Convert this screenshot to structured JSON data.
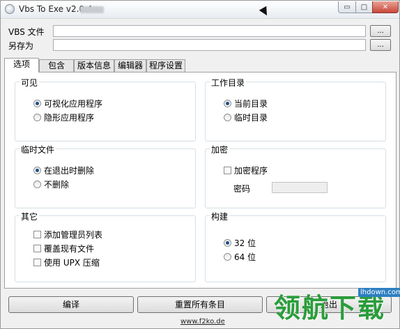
{
  "window": {
    "title": "Vbs To Exe v2.0.4",
    "controls": {
      "minimize": "▭",
      "maximize": "□",
      "close": "✕"
    }
  },
  "inputs": {
    "vbs_label": "VBS 文件",
    "vbs_value": "",
    "vbs_browse": "...",
    "saveas_label": "另存为",
    "saveas_value": "",
    "saveas_browse": "..."
  },
  "tabs": [
    "选项",
    "包含",
    "版本信息",
    "编辑器",
    "程序设置"
  ],
  "active_tab": "选项",
  "groups": {
    "visible": {
      "title": "可见",
      "options": [
        {
          "label": "可视化应用程序",
          "selected": true
        },
        {
          "label": "隐形应用程序",
          "selected": false
        }
      ]
    },
    "workdir": {
      "title": "工作目录",
      "options": [
        {
          "label": "当前目录",
          "selected": true
        },
        {
          "label": "临时目录",
          "selected": false
        }
      ]
    },
    "tempfile": {
      "title": "临时文件",
      "options": [
        {
          "label": "在退出时删除",
          "selected": true
        },
        {
          "label": "不删除",
          "selected": false
        }
      ]
    },
    "encrypt": {
      "title": "加密",
      "checkbox_label": "加密程序",
      "checked": false,
      "password_label": "密码",
      "password_value": ""
    },
    "other": {
      "title": "其它",
      "checkboxes": [
        {
          "label": "添加管理员列表",
          "checked": false
        },
        {
          "label": "覆盖现有文件",
          "checked": false
        },
        {
          "label": "使用 UPX 压缩",
          "checked": false
        }
      ]
    },
    "build": {
      "title": "构建",
      "options": [
        {
          "label": "32 位",
          "selected": true
        },
        {
          "label": "64 位",
          "selected": false
        }
      ]
    }
  },
  "buttons": {
    "compile": "编译",
    "reset": "重置所有条目",
    "exit": "退出"
  },
  "footer": {
    "link": "www.f2ko.de"
  },
  "watermark": {
    "text": "领航下载",
    "sub": "lhdown.com"
  }
}
